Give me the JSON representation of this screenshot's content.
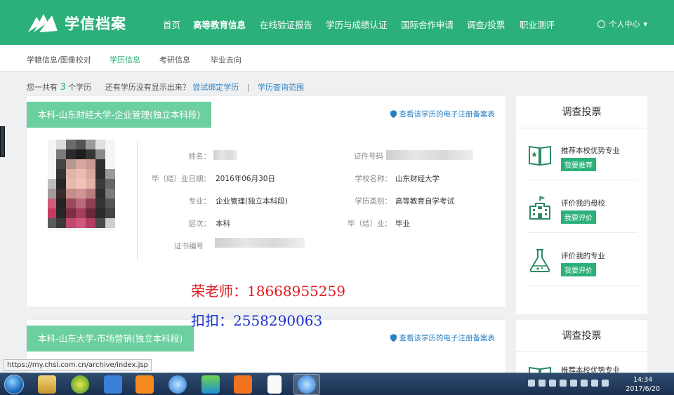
{
  "topnav": {
    "logo_text": "学信档案",
    "items": [
      "首页",
      "高等教育信息",
      "在线验证报告",
      "学历与成绩认证",
      "国际合作申请",
      "调查/投票",
      "职业测评"
    ],
    "active_index": 1,
    "user_center": "个人中心"
  },
  "subnav": {
    "items": [
      "学籍信息/图像校对",
      "学历信息",
      "考研信息",
      "毕业去向"
    ],
    "active_index": 1
  },
  "summary": {
    "prefix": "您一共有",
    "count": "3",
    "suffix": "个学历",
    "question": "还有学历没有显示出来？",
    "bind_link": "尝试绑定学历",
    "separator": "|",
    "scope_link": "学历查询范围"
  },
  "record1": {
    "degree_tag": "本科-山东财经大学-企业管理(独立本科段)",
    "cert_link": "查看该学历的电子注册备案表",
    "labels": {
      "name": "姓名：",
      "grad_date": "毕（结）业日期：",
      "major": "专业：",
      "level": "层次：",
      "cert_no": "证书编号",
      "id_no": "证件号码",
      "school": "学校名称：",
      "edu_type": "学历类别：",
      "grad_status": "毕（结）业："
    },
    "values": {
      "grad_date": "2016年06月30日",
      "major": "企业管理(独立本科段)",
      "level": "本科",
      "school": "山东财经大学",
      "edu_type": "高等教育自学考试",
      "grad_status": "毕业"
    }
  },
  "record2": {
    "degree_tag": "本科-山东大学-市场营销(独立本科段)",
    "cert_link": "查看该学历的电子注册备案表"
  },
  "side": {
    "title": "调查投票",
    "items": [
      {
        "text": "推荐本校优势专业",
        "button": "我要推荐"
      },
      {
        "text": "评价我的母校",
        "button": "我要评价"
      },
      {
        "text": "评价我的专业",
        "button": "我要评价"
      }
    ],
    "second_item_text": "推荐本校优势专业"
  },
  "overlay": {
    "line1": "荣老师：18668955259",
    "line2": "扣扣：2558290063"
  },
  "status_url": "https://my.chsi.com.cn/archive/index.jsp",
  "taskbar": {
    "time": "14:34",
    "date": "2017/6/20"
  },
  "colors": {
    "brand": "#2cb07a",
    "tag": "#6ccf9f",
    "link": "#2a7fc1",
    "overlay_red": "#e0191f",
    "overlay_blue": "#1a2fd0"
  }
}
